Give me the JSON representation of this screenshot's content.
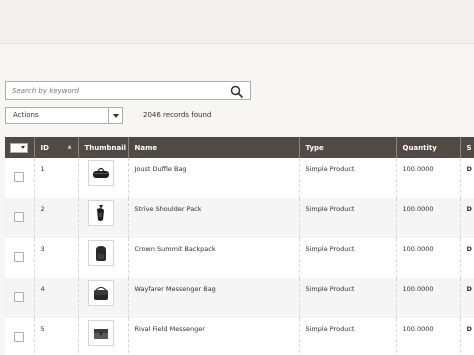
{
  "search": {
    "placeholder": "Search by keyword",
    "value": ""
  },
  "actions": {
    "label": "Actions"
  },
  "records_found": "2046 records found",
  "grid": {
    "columns": {
      "id": "ID",
      "thumbnail": "Thumbnail",
      "name": "Name",
      "type": "Type",
      "quantity": "Quantity",
      "status": "S"
    },
    "rows": [
      {
        "id": "1",
        "name": "Joust Duffle Bag",
        "type": "Simple Product",
        "quantity": "100.0000",
        "status": "D",
        "thumb_icon": "duffle-bag-icon"
      },
      {
        "id": "2",
        "name": "Strive Shoulder Pack",
        "type": "Simple Product",
        "quantity": "100.0000",
        "status": "D",
        "thumb_icon": "shoulder-pack-icon"
      },
      {
        "id": "3",
        "name": "Crown Summit Backpack",
        "type": "Simple Product",
        "quantity": "100.0000",
        "status": "D",
        "thumb_icon": "backpack-icon"
      },
      {
        "id": "4",
        "name": "Wayfarer Messenger Bag",
        "type": "Simple Product",
        "quantity": "100.0000",
        "status": "D",
        "thumb_icon": "messenger-bag-icon"
      },
      {
        "id": "5",
        "name": "Rival Field Messenger",
        "type": "Simple Product",
        "quantity": "100.0000",
        "status": "D",
        "thumb_icon": "field-messenger-icon"
      }
    ]
  },
  "colors": {
    "header_bg": "#514943",
    "row_alt": "#f5f5f5",
    "page_bg": "#f7f6f4"
  }
}
